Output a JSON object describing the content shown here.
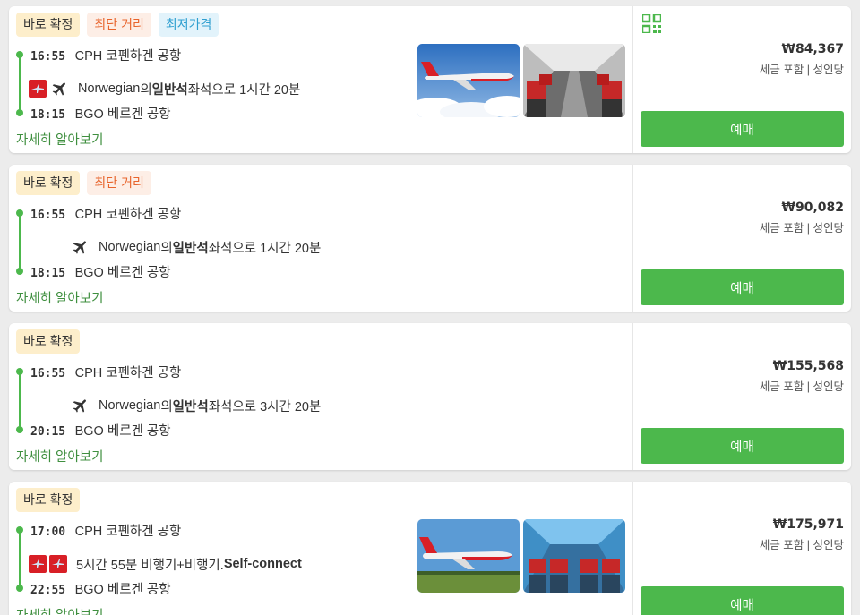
{
  "flights": [
    {
      "badges": [
        {
          "label": "바로 확정",
          "kind": "confirm"
        },
        {
          "label": "최단 거리",
          "kind": "short"
        },
        {
          "label": "최저가격",
          "kind": "cheap"
        }
      ],
      "depart_time": "16:55",
      "depart_airport": "CPH 코펜하겐 공항",
      "arrive_time": "18:15",
      "arrive_airport": "BGO 베르겐 공항",
      "airline": "Norwegian",
      "airline_suffix": "의 ",
      "cabin": "일반석",
      "duration_text": " 좌석으로 1시간 20분",
      "airline_logos": 1,
      "details_label": "자세히 알아보기",
      "price": "₩84,367",
      "tax_note": "세금 포함 | 성인당",
      "book_label": "예매",
      "photos": true,
      "qr": true
    },
    {
      "badges": [
        {
          "label": "바로 확정",
          "kind": "confirm"
        },
        {
          "label": "최단 거리",
          "kind": "short"
        }
      ],
      "depart_time": "16:55",
      "depart_airport": "CPH 코펜하겐 공항",
      "arrive_time": "18:15",
      "arrive_airport": "BGO 베르겐 공항",
      "airline": "Norwegian",
      "airline_suffix": "의 ",
      "cabin": "일반석",
      "duration_text": " 좌석으로 1시간 20분",
      "airline_logos": 0,
      "details_label": "자세히 알아보기",
      "price": "₩90,082",
      "tax_note": "세금 포함 | 성인당",
      "book_label": "예매",
      "photos": false,
      "qr": false
    },
    {
      "badges": [
        {
          "label": "바로 확정",
          "kind": "confirm"
        }
      ],
      "depart_time": "16:55",
      "depart_airport": "CPH 코펜하겐 공항",
      "arrive_time": "20:15",
      "arrive_airport": "BGO 베르겐 공항",
      "airline": "Norwegian",
      "airline_suffix": "의 ",
      "cabin": "일반석",
      "duration_text": " 좌석으로 3시간 20분",
      "airline_logos": 0,
      "details_label": "자세히 알아보기",
      "price": "₩155,568",
      "tax_note": "세금 포함 | 성인당",
      "book_label": "예매",
      "photos": false,
      "qr": false
    },
    {
      "badges": [
        {
          "label": "바로 확정",
          "kind": "confirm"
        }
      ],
      "depart_time": "17:00",
      "depart_airport": "CPH 코펜하겐 공항",
      "arrive_time": "22:55",
      "arrive_airport": "BGO 베르겐 공항",
      "connect_text": "5시간 55분 비행기+비행기. ",
      "connect_bold": "Self-connect",
      "airline_logos": 2,
      "details_label": "자세히 알아보기",
      "price": "₩175,971",
      "tax_note": "세금 포함 | 성인당",
      "book_label": "예매",
      "photos": true,
      "qr": false
    }
  ],
  "colors": {
    "accent": "#4cb84c",
    "brand_red": "#d81f26"
  },
  "icons": {
    "plane": "airplane-icon",
    "logo": "norwegian-logo-icon",
    "qr": "qr-code-icon"
  }
}
